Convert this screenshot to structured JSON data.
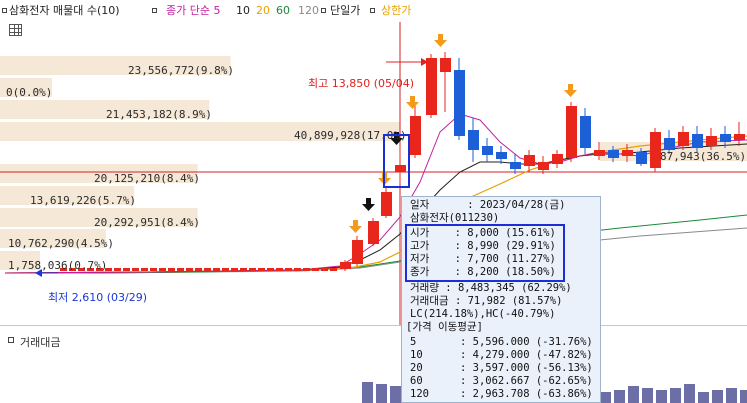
{
  "legend": {
    "items": [
      {
        "label": "삼화전자 매물대 수(10)",
        "color": "#222222"
      },
      {
        "label": "종가 단순 5",
        "color": "#c0209f"
      },
      {
        "label": "10",
        "color": "#222222"
      },
      {
        "label": "20",
        "color": "#e8a000"
      },
      {
        "label": "60",
        "color": "#1a8a3a"
      },
      {
        "label": "120",
        "color": "#8a8a8a"
      },
      {
        "label": "단일가",
        "color": "#222222"
      },
      {
        "label": "상한가",
        "color": "#e8a000"
      }
    ]
  },
  "volume_profile": [
    {
      "label": "23,556,772(9.8%)",
      "fraction": 0.098
    },
    {
      "label": "0(0.0%)",
      "fraction": 0.0
    },
    {
      "label": "21,453,182(8.9%)",
      "fraction": 0.089
    },
    {
      "label": "40,899,928(17.0%)",
      "fraction": 0.17
    },
    {
      "label": "20,125,210(8.4%)",
      "fraction": 0.084
    },
    {
      "label": "13,619,226(5.7%)",
      "fraction": 0.057
    },
    {
      "label": "20,292,951(8.4%)",
      "fraction": 0.084
    },
    {
      "label": "10,762,290(4.5%)",
      "fraction": 0.045
    },
    {
      "label": "1,758,036(0.7%)",
      "fraction": 0.007
    }
  ],
  "right_profile_label": "87,943(36.5%)",
  "high_marker": "최고 13,850 (05/04)",
  "low_marker": "최저 2,610 (03/29)",
  "info": {
    "date_label": "일자",
    "date_value": ": 2023/04/28(금)",
    "name": "삼화전자(011230)",
    "ohlc": [
      {
        "k": "시가",
        "v": ": 8,000 (15.61%)"
      },
      {
        "k": "고가",
        "v": ": 8,990 (29.91%)"
      },
      {
        "k": "저가",
        "v": ": 7,700 (11.27%)"
      },
      {
        "k": "종가",
        "v": ": 8,200 (18.50%)"
      }
    ],
    "volume": "거래량   : 8,483,345 (62.29%)",
    "amount": "거래대금 : 71,982 (81.57%)",
    "lchc": "LC(214.18%),HC(-40.79%)",
    "ma_title": "[가격 이동평균]",
    "ma": [
      {
        "k": "5",
        "v": ": 5,596.000 (-31.76%)"
      },
      {
        "k": "10",
        "v": ": 4,279.000 (-47.82%)"
      },
      {
        "k": "20",
        "v": ": 3,597.000 (-56.13%)"
      },
      {
        "k": "60",
        "v": ": 3,062.667 (-62.65%)"
      },
      {
        "k": "120",
        "v": ": 2,963.708 (-63.86%)"
      }
    ]
  },
  "lower_panel_title": "거래대금",
  "colors": {
    "up": "#e8261b",
    "down": "#1d5fd6",
    "ma5": "#c0209f",
    "ma10": "#222222",
    "ma20": "#e8a000",
    "ma60": "#1a8a3a",
    "profile": "#f6e8d6",
    "crosshair": "#d42020",
    "volume_bar": "#6b6fa6"
  }
}
